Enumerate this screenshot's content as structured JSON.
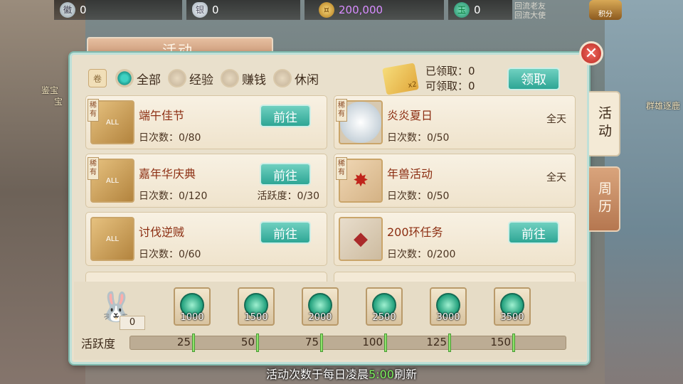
{
  "top_bar": {
    "badge_value": "0",
    "silver_value": "0",
    "coin_value": "200,000",
    "jade_value": "0",
    "recall_line1": "回流老友",
    "recall_line2": "回流大使",
    "points_label": "积分"
  },
  "background": {
    "left_label1": "鉴宝",
    "left_label2": "宝",
    "right_label": "群雄逐鹿"
  },
  "panel": {
    "title": "活动",
    "close_symbol": "✕"
  },
  "filters": {
    "options": [
      "全部",
      "经验",
      "赚钱",
      "休闲"
    ],
    "selected": "全部"
  },
  "claim": {
    "claimed_label": "已领取：0",
    "claimable_label": "可领取：0",
    "button_label": "领取",
    "ticket_badge": "x2"
  },
  "activities": [
    {
      "name": "端午佳节",
      "count": "日次数：0/80",
      "rare": "稀有",
      "action": "前往",
      "thumb": "ALL"
    },
    {
      "name": "炎炎夏日",
      "count": "日次数：0/50",
      "rare": "稀有",
      "time": "全天",
      "thumb": ""
    },
    {
      "name": "嘉年华庆典",
      "count": "日次数：0/120",
      "rare": "稀有",
      "action": "前往",
      "extra": "活跃度：0/30",
      "thumb": "ALL"
    },
    {
      "name": "年兽活动",
      "count": "日次数：0/50",
      "rare": "稀有",
      "time": "全天",
      "thumb": ""
    },
    {
      "name": "讨伐逆贼",
      "count": "日次数：0/60",
      "action": "前往",
      "thumb": "ALL"
    },
    {
      "name": "200环任务",
      "count": "日次数：0/200",
      "action": "前往",
      "thumb": ""
    }
  ],
  "side_tabs": [
    "活动",
    "周历"
  ],
  "activity_points": {
    "label": "活跃度",
    "current": "0",
    "progress_fraction": 0.0,
    "rewards": [
      "1000",
      "1500",
      "2000",
      "2500",
      "3000",
      "3500"
    ],
    "milestones": [
      "25",
      "50",
      "75",
      "100",
      "125",
      "150"
    ]
  },
  "footer": {
    "prefix": "活动次数于每日凌晨",
    "time": "5:00",
    "suffix": "刷新"
  },
  "colors": {
    "accent_teal": "#2ea695",
    "title_red": "#8c2e12",
    "coin_purple": "#d88cff"
  }
}
